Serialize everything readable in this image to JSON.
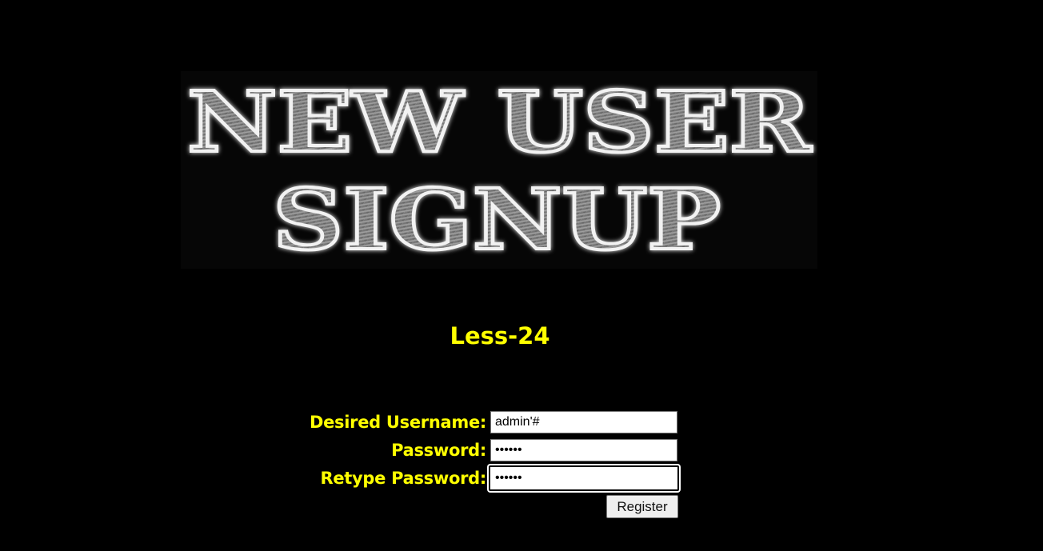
{
  "banner": {
    "line1": "NEW USER",
    "line2": "SIGNUP"
  },
  "lesson": {
    "title": "Less-24"
  },
  "form": {
    "username_label": "Desired Username:",
    "username_value": "admin'#",
    "password_label": "Password:",
    "password_value": "••••••",
    "retype_label": "Retype Password:",
    "retype_value": "••••••",
    "register_label": "Register"
  },
  "colors": {
    "background": "#000000",
    "label_text": "#ffff00",
    "banner_text": "#8c8c8c"
  }
}
